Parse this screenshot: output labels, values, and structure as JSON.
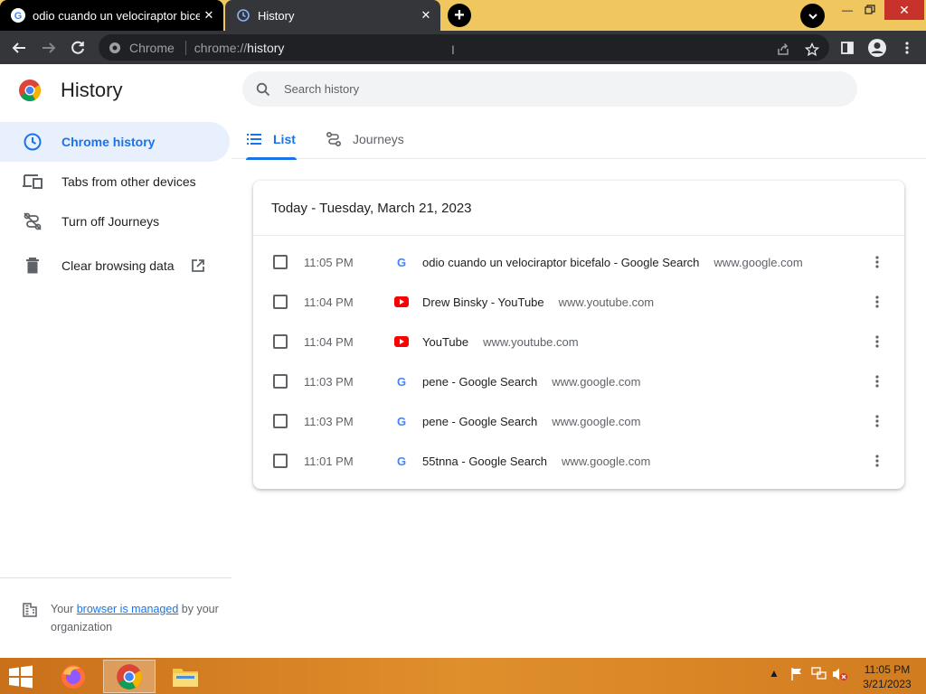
{
  "browser": {
    "tabs": [
      {
        "title": "odio cuando un velociraptor bicefalo - Google Search",
        "favicon": "google-icon"
      },
      {
        "title": "History",
        "favicon": "history-icon"
      }
    ],
    "omnibox": {
      "chip": "Chrome",
      "url_scheme": "chrome://",
      "url_path": "history"
    }
  },
  "history_page": {
    "title": "History",
    "search_placeholder": "Search history",
    "nav": [
      {
        "label": "Chrome history",
        "icon": "clock-icon",
        "selected": true
      },
      {
        "label": "Tabs from other devices",
        "icon": "devices-icon"
      },
      {
        "label": "Turn off Journeys",
        "icon": "journeys-off-icon"
      },
      {
        "label": "Clear browsing data",
        "icon": "trash-icon"
      }
    ],
    "tabs": [
      {
        "label": "List"
      },
      {
        "label": "Journeys"
      }
    ],
    "managed_prefix": "Your ",
    "managed_link": "browser is managed",
    "managed_suffix": " by your organization",
    "day_header": "Today - Tuesday, March 21, 2023",
    "entries": [
      {
        "time": "11:05 PM",
        "title": "odio cuando un velociraptor bicefalo - Google Search",
        "domain": "www.google.com",
        "favicon": "google-icon"
      },
      {
        "time": "11:04 PM",
        "title": "Drew Binsky - YouTube",
        "domain": "www.youtube.com",
        "favicon": "youtube-icon"
      },
      {
        "time": "11:04 PM",
        "title": "YouTube",
        "domain": "www.youtube.com",
        "favicon": "youtube-icon"
      },
      {
        "time": "11:03 PM",
        "title": "pene - Google Search",
        "domain": "www.google.com",
        "favicon": "google-icon"
      },
      {
        "time": "11:03 PM",
        "title": "pene - Google Search",
        "domain": "www.google.com",
        "favicon": "google-icon"
      },
      {
        "time": "11:01 PM",
        "title": "55tnna - Google Search",
        "domain": "www.google.com",
        "favicon": "google-icon"
      }
    ]
  },
  "taskbar": {
    "clock_time": "11:05 PM",
    "clock_date": "3/21/2023"
  },
  "colors": {
    "accent": "#1a73e8",
    "tab_strip": "#efc75e",
    "toolbar": "#35363a",
    "selected_nav": "#e8f0fe"
  }
}
